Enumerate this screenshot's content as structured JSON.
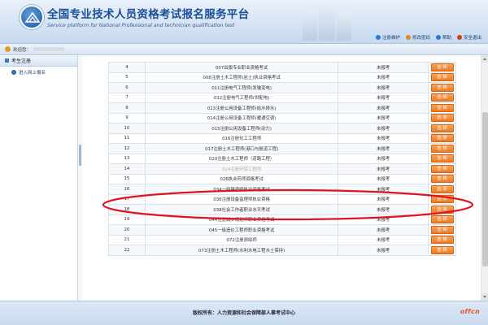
{
  "header": {
    "title_cn": "全国专业技术人员资格考试报名服务平台",
    "title_en": "Service platform for National Professional and technician qualification test",
    "links": [
      {
        "label": "注册维护",
        "icon": "home-icon",
        "color": "#2f7ad0"
      },
      {
        "label": "修改密码",
        "icon": "key-icon",
        "color": "#e08a1f"
      },
      {
        "label": "帮助",
        "icon": "help-icon",
        "color": "#2f7ad0"
      },
      {
        "label": "安全退出",
        "icon": "power-icon",
        "color": "#d83a2a"
      }
    ]
  },
  "welcome": {
    "label": "欢迎您："
  },
  "sidebar": {
    "section_label": "考生注册",
    "items": [
      {
        "label": "进入网上报名"
      }
    ]
  },
  "table": {
    "rows": [
      {
        "no": "4",
        "name": "007出版专业职业资格考试",
        "status": "未报考",
        "op": "选 择"
      },
      {
        "no": "5",
        "name": "008注册土木工程师(岩土)执业资格考试",
        "status": "未报考",
        "op": "选 择"
      },
      {
        "no": "6",
        "name": "011注册电气工程师(发输变电)",
        "status": "未报考",
        "op": "选 择"
      },
      {
        "no": "7",
        "name": "012注册电气工程师(供配电)",
        "status": "未报考",
        "op": "选 择"
      },
      {
        "no": "8",
        "name": "013注册公用设备工程师(给水排水)",
        "status": "未报考",
        "op": "选 择"
      },
      {
        "no": "9",
        "name": "014注册公用设备工程师(暖通空调)",
        "status": "未报考",
        "op": "选 择"
      },
      {
        "no": "10",
        "name": "015注册公用设备工程师(动力)",
        "status": "未报考",
        "op": "选 择"
      },
      {
        "no": "11",
        "name": "016注册化工工程师",
        "status": "未报考",
        "op": "选 择"
      },
      {
        "no": "12",
        "name": "017注册土木工程师(港口与航道工程)",
        "status": "未报考",
        "op": "选 择"
      },
      {
        "no": "13",
        "name": "020注册土木工程师（道路工程）",
        "status": "未报考",
        "op": "选 择"
      },
      {
        "no": "14",
        "name": "024注册环保工程师",
        "status": "未报考",
        "op": "选 择",
        "dimmed": true
      },
      {
        "no": "15",
        "name": "026执业药师资格考试",
        "status": "未报考",
        "op": "选 择"
      },
      {
        "no": "16",
        "name": "034一级建造师执业资格考试",
        "status": "未报考",
        "op": "选 择"
      },
      {
        "no": "17",
        "name": "036注册设备监理师执业资格",
        "status": "未报考",
        "op": "选 择"
      },
      {
        "no": "18",
        "name": "038社会工作者职业水平考试",
        "status": "未报考",
        "op": "选 择"
      },
      {
        "no": "19",
        "name": "044注册城乡规划师职业资格考试",
        "status": "未报考",
        "op": "选 择"
      },
      {
        "no": "20",
        "name": "045一级造价工程师职业资格考试",
        "status": "未报考",
        "op": "选 择"
      },
      {
        "no": "21",
        "name": "072注册测绘师",
        "status": "未报考",
        "op": "选 择"
      },
      {
        "no": "22",
        "name": "073注册土木工程师(水利水电工程水土保持)",
        "status": "未报考",
        "op": "选 择"
      }
    ]
  },
  "footer": {
    "copyright": "版权所有：人力资源和社会保障部人事考试中心"
  },
  "watermark": "offcn",
  "colors": {
    "accent": "#1b4f96",
    "button": "#ec7a22",
    "highlight": "#e0141e"
  }
}
